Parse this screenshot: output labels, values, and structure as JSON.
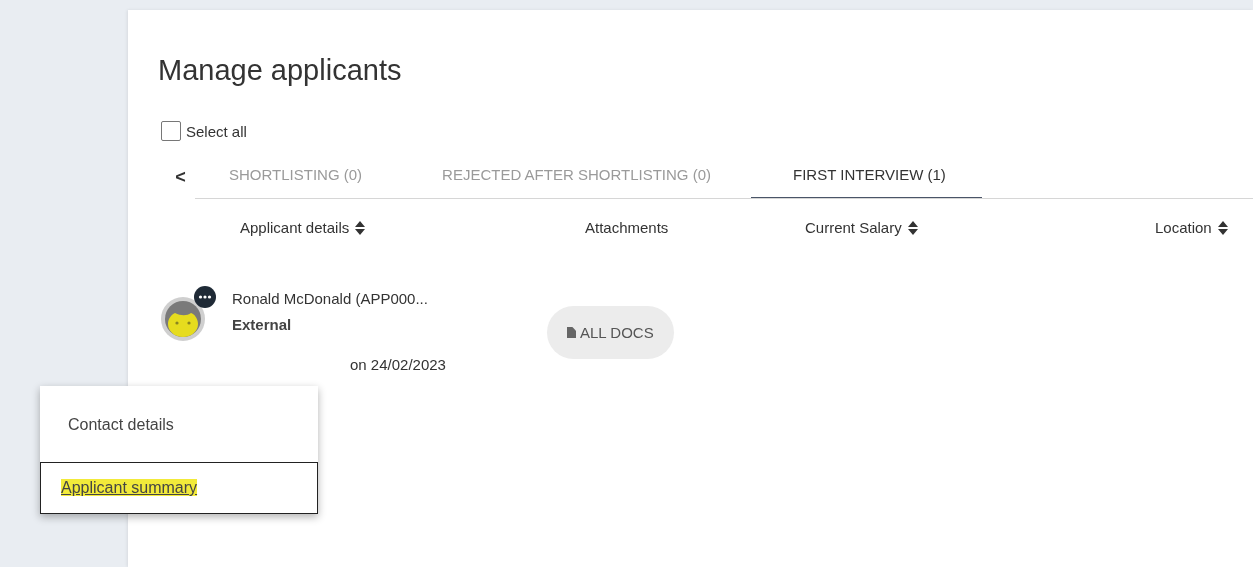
{
  "page": {
    "title": "Manage applicants"
  },
  "select_all": {
    "label": "Select all",
    "checked": false
  },
  "tabs_nav": {
    "prev": "<"
  },
  "tabs": [
    {
      "label": "SHORTLISTING (0)",
      "selected": false
    },
    {
      "label": "REJECTED AFTER SHORTLISTING (0)",
      "selected": false
    },
    {
      "label": "FIRST INTERVIEW (1)",
      "selected": true
    }
  ],
  "columns": [
    {
      "label": "Applicant details",
      "sortable": true
    },
    {
      "label": "Attachments",
      "sortable": false
    },
    {
      "label": "Current Salary",
      "sortable": true
    },
    {
      "label": "Location",
      "sortable": true
    }
  ],
  "applicant": {
    "name": "Ronald McDonald (APP000...",
    "type": "External",
    "date": "on 24/02/2023",
    "attachments_button": "ALL DOCS"
  },
  "menu": {
    "items": [
      {
        "label": "Contact details",
        "highlighted": false
      },
      {
        "label": "Applicant summary",
        "highlighted": true
      }
    ]
  }
}
